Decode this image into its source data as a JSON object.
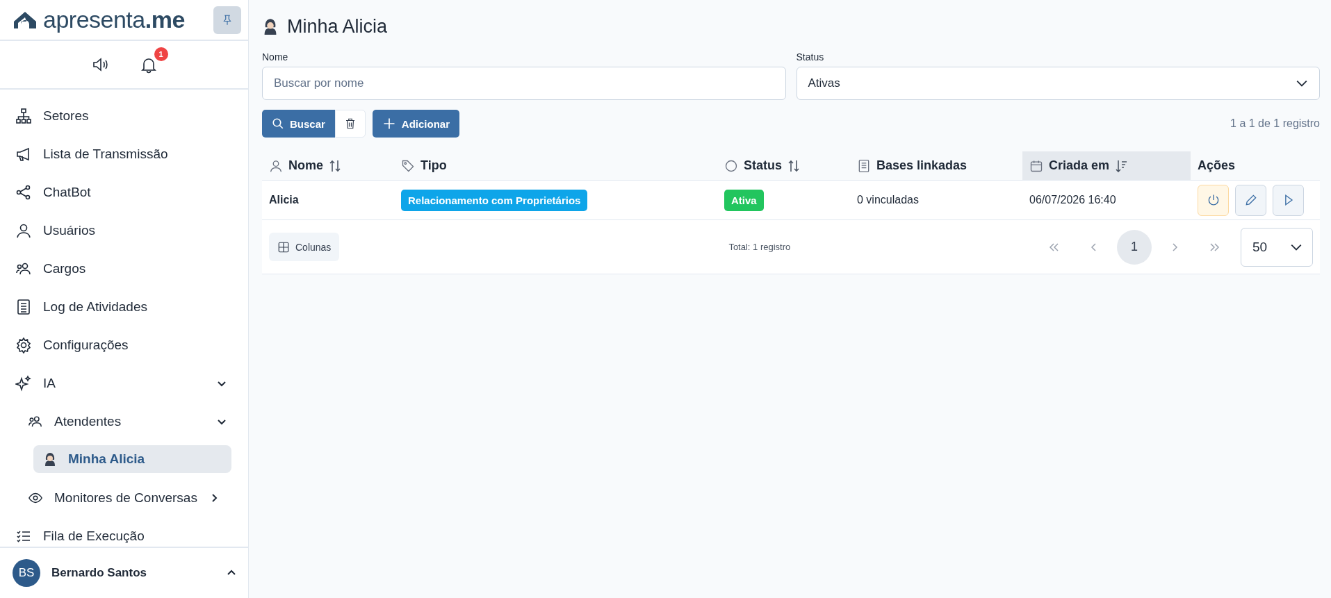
{
  "sidebar": {
    "logo": {
      "text_light": "apresenta",
      "text_bold": ".me"
    },
    "notifications": {
      "count": "1"
    },
    "items": [
      {
        "label": "Setores",
        "selected": false
      },
      {
        "label": "Lista de Transmissão",
        "selected": false
      },
      {
        "label": "ChatBot",
        "selected": false
      },
      {
        "label": "Usuários",
        "selected": false
      },
      {
        "label": "Cargos",
        "selected": false
      },
      {
        "label": "Log de Atividades",
        "selected": false
      },
      {
        "label": "Configurações",
        "selected": false
      },
      {
        "label": "IA",
        "selected": false,
        "expanded": true,
        "children": [
          {
            "label": "Atendentes",
            "selected": false,
            "expanded": true,
            "children": [
              {
                "label": "Minha Alicia",
                "selected": true
              }
            ]
          },
          {
            "label": "Monitores de Conversas",
            "selected": false,
            "expanded": false
          }
        ]
      },
      {
        "label": "Fila de Execução",
        "selected": false
      }
    ],
    "user": {
      "initials": "BS",
      "name": "Bernardo Santos"
    }
  },
  "page": {
    "title": "Minha Alicia",
    "filters": [
      {
        "kind": "input",
        "label": "Nome",
        "placeholder": "Buscar por nome"
      },
      {
        "kind": "select",
        "label": "Status",
        "value": "Ativas"
      }
    ],
    "buttons": [
      {
        "kind": "search",
        "label": "Buscar"
      },
      {
        "kind": "clear"
      },
      {
        "kind": "add",
        "label": "Adicionar"
      }
    ],
    "range": "1 a 1 de 1 registro",
    "table": {
      "columns": [
        {
          "label": "Nome",
          "sortable": true,
          "sorted": false
        },
        {
          "label": "Tipo",
          "sortable": false,
          "sorted": false
        },
        {
          "label": "Status",
          "sortable": true,
          "sorted": false
        },
        {
          "label": "Bases linkadas",
          "sortable": false,
          "sorted": false
        },
        {
          "label": "Criada em",
          "sortable": true,
          "sorted": true
        },
        {
          "label": "Ações",
          "sortable": false,
          "sorted": false
        }
      ],
      "rows": [
        {
          "name": "Alicia",
          "type": {
            "label": "Relacionamento com Proprietários",
            "color": "#0ea5e9"
          },
          "status": {
            "label": "Ativa",
            "color": "#22c55e"
          },
          "bases": "0 vinculadas",
          "created": "06/07/2026 16:40"
        }
      ]
    },
    "columns_button": "Colunas",
    "total": "Total: 1 registro",
    "pagination": [
      {
        "kind": "first"
      },
      {
        "kind": "prev"
      },
      {
        "kind": "page",
        "label": "1",
        "selected": true
      },
      {
        "kind": "next"
      },
      {
        "kind": "last"
      }
    ],
    "page_size": "50"
  }
}
